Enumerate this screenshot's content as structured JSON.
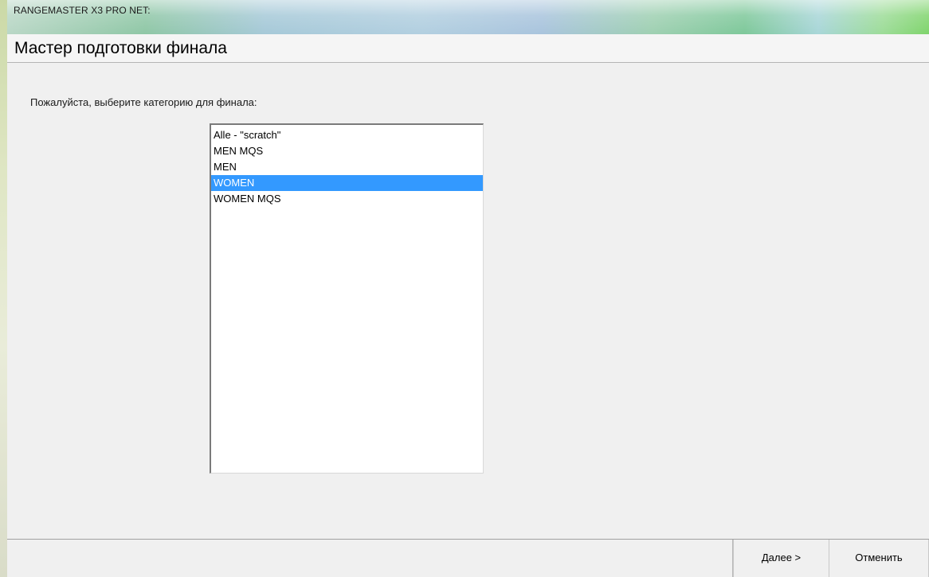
{
  "window": {
    "title": "RANGEMASTER X3 PRO NET:"
  },
  "wizard": {
    "title": "Мастер подготовки финала",
    "prompt": "Пожалуйста, выберите категорию для финала:"
  },
  "category_list": {
    "items": [
      {
        "label": "Alle - \"scratch\"",
        "selected": false
      },
      {
        "label": "MEN MQS",
        "selected": false
      },
      {
        "label": "MEN",
        "selected": false
      },
      {
        "label": "WOMEN",
        "selected": true
      },
      {
        "label": "WOMEN MQS",
        "selected": false
      }
    ],
    "selection_color": "#3399ff"
  },
  "buttons": {
    "next_label": "Далее >",
    "cancel_label": "Отменить"
  }
}
